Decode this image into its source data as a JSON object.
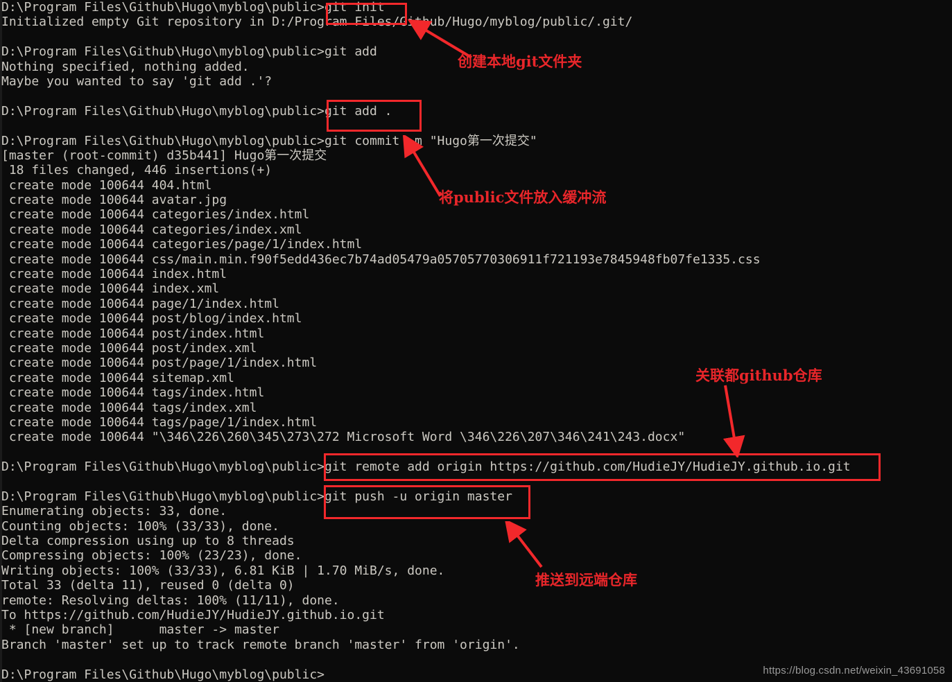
{
  "window": {
    "background": "#0b0b0b",
    "text_color": "#ccc9c2",
    "annotation_color": "#e8262a"
  },
  "terminal": {
    "lines": [
      "D:\\Program Files\\Github\\Hugo\\myblog\\public>git init",
      "Initialized empty Git repository in D:/Program Files/Github/Hugo/myblog/public/.git/",
      "",
      "D:\\Program Files\\Github\\Hugo\\myblog\\public>git add",
      "Nothing specified, nothing added.",
      "Maybe you wanted to say 'git add .'?",
      "",
      "D:\\Program Files\\Github\\Hugo\\myblog\\public>git add .",
      "",
      "D:\\Program Files\\Github\\Hugo\\myblog\\public>git commit -m \"Hugo第一次提交\"",
      "[master (root-commit) d35b441] Hugo第一次提交",
      " 18 files changed, 446 insertions(+)",
      " create mode 100644 404.html",
      " create mode 100644 avatar.jpg",
      " create mode 100644 categories/index.html",
      " create mode 100644 categories/index.xml",
      " create mode 100644 categories/page/1/index.html",
      " create mode 100644 css/main.min.f90f5edd436ec7b74ad05479a05705770306911f721193e7845948fb07fe1335.css",
      " create mode 100644 index.html",
      " create mode 100644 index.xml",
      " create mode 100644 page/1/index.html",
      " create mode 100644 post/blog/index.html",
      " create mode 100644 post/index.html",
      " create mode 100644 post/index.xml",
      " create mode 100644 post/page/1/index.html",
      " create mode 100644 sitemap.xml",
      " create mode 100644 tags/index.html",
      " create mode 100644 tags/index.xml",
      " create mode 100644 tags/page/1/index.html",
      " create mode 100644 \"\\346\\226\\260\\345\\273\\272 Microsoft Word \\346\\226\\207\\346\\241\\243.docx\"",
      "",
      "D:\\Program Files\\Github\\Hugo\\myblog\\public>git remote add origin https://github.com/HudieJY/HudieJY.github.io.git",
      "",
      "D:\\Program Files\\Github\\Hugo\\myblog\\public>git push -u origin master",
      "Enumerating objects: 33, done.",
      "Counting objects: 100% (33/33), done.",
      "Delta compression using up to 8 threads",
      "Compressing objects: 100% (23/23), done.",
      "Writing objects: 100% (33/33), 6.81 KiB | 1.70 MiB/s, done.",
      "Total 33 (delta 11), reused 0 (delta 0)",
      "remote: Resolving deltas: 100% (11/11), done.",
      "To https://github.com/HudieJY/HudieJY.github.io.git",
      " * [new branch]      master -> master",
      "Branch 'master' set up to track remote branch 'master' from 'origin'.",
      "",
      "D:\\Program Files\\Github\\Hugo\\myblog\\public>"
    ]
  },
  "annotations": [
    {
      "id": "git-init",
      "text": "创建本地git文件夹"
    },
    {
      "id": "git-add",
      "text": "将public文件放入缓冲流"
    },
    {
      "id": "git-remote",
      "text": "关联都github仓库"
    },
    {
      "id": "git-push",
      "text": "推送到远端仓库"
    }
  ],
  "highlight_boxes": [
    {
      "id": "git-init-box",
      "command": "git init"
    },
    {
      "id": "git-add-dot-box",
      "command": "git add ."
    },
    {
      "id": "git-remote-add-box",
      "command": "git remote add origin https://github.com/HudieJY/HudieJY.github.io.git"
    },
    {
      "id": "git-push-box",
      "command": "git push -u origin master"
    }
  ],
  "watermark": {
    "text": "https://blog.csdn.net/weixin_43691058"
  }
}
